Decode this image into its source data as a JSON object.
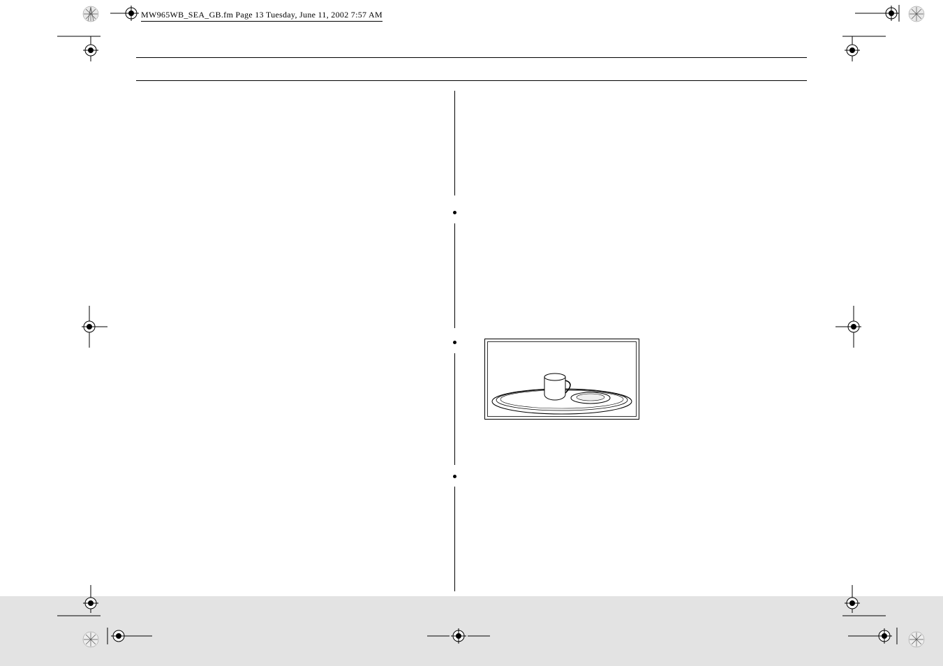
{
  "header": {
    "filename_line": "MW965WB_SEA_GB.fm  Page 13  Tuesday, June 11, 2002  7:57 AM"
  },
  "icons": {
    "register_mark": "register-mark-icon",
    "corner_swirl": "swirl-badge-icon"
  },
  "illustration": {
    "name": "microwave-turntable-with-cup-and-plate"
  }
}
